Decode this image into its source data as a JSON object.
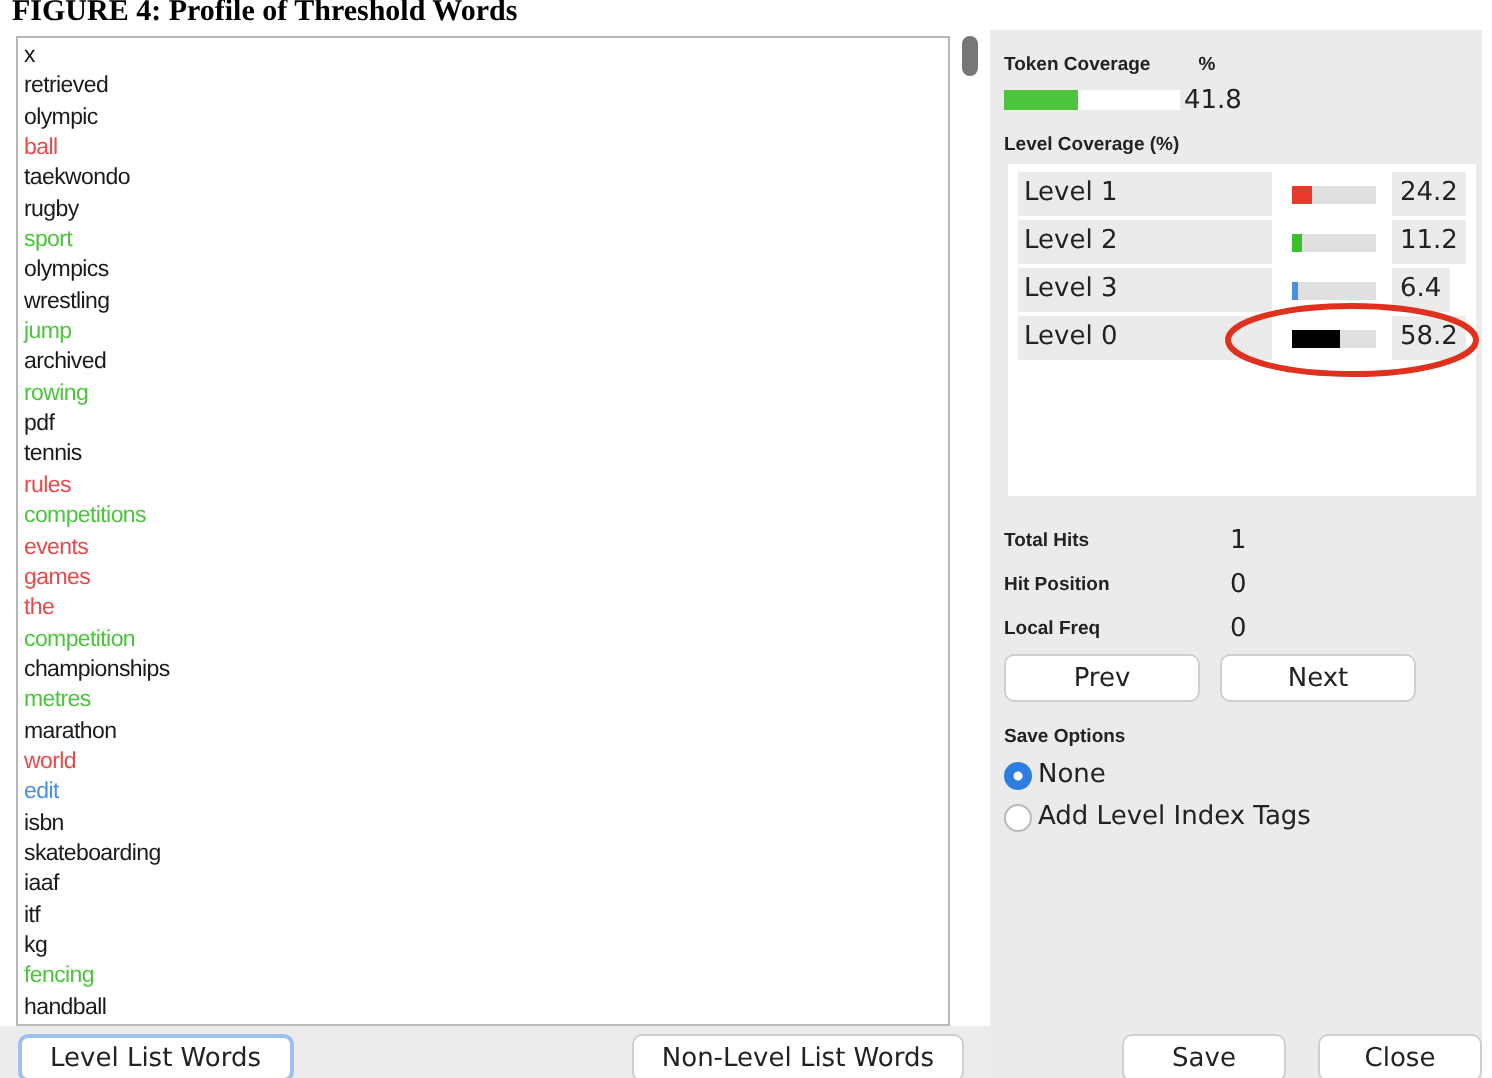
{
  "caption": "FIGURE 4: Profile of Threshold Words",
  "words": [
    {
      "text": "x",
      "color": "#1a1a1a"
    },
    {
      "text": "retrieved",
      "color": "#1a1a1a"
    },
    {
      "text": "olympic",
      "color": "#1a1a1a"
    },
    {
      "text": "ball",
      "color": "#e84a4a"
    },
    {
      "text": "taekwondo",
      "color": "#1a1a1a"
    },
    {
      "text": "rugby",
      "color": "#1a1a1a"
    },
    {
      "text": "sport",
      "color": "#4cc43c"
    },
    {
      "text": "olympics",
      "color": "#1a1a1a"
    },
    {
      "text": "wrestling",
      "color": "#1a1a1a"
    },
    {
      "text": "jump",
      "color": "#4cc43c"
    },
    {
      "text": "archived",
      "color": "#1a1a1a"
    },
    {
      "text": "rowing",
      "color": "#4cc43c"
    },
    {
      "text": "pdf",
      "color": "#1a1a1a"
    },
    {
      "text": "tennis",
      "color": "#1a1a1a"
    },
    {
      "text": "rules",
      "color": "#e84a4a"
    },
    {
      "text": "competitions",
      "color": "#4cc43c"
    },
    {
      "text": "events",
      "color": "#e84a4a"
    },
    {
      "text": "games",
      "color": "#e84a4a"
    },
    {
      "text": "the",
      "color": "#e84a4a"
    },
    {
      "text": "competition",
      "color": "#4cc43c"
    },
    {
      "text": "championships",
      "color": "#1a1a1a"
    },
    {
      "text": "metres",
      "color": "#4cc43c"
    },
    {
      "text": "marathon",
      "color": "#1a1a1a"
    },
    {
      "text": "world",
      "color": "#e84a4a"
    },
    {
      "text": "edit",
      "color": "#4a8fe2"
    },
    {
      "text": "isbn",
      "color": "#1a1a1a"
    },
    {
      "text": "skateboarding",
      "color": "#1a1a1a"
    },
    {
      "text": "iaaf",
      "color": "#1a1a1a"
    },
    {
      "text": "itf",
      "color": "#1a1a1a"
    },
    {
      "text": "kg",
      "color": "#1a1a1a"
    },
    {
      "text": "fencing",
      "color": "#4cc43c"
    },
    {
      "text": "handball",
      "color": "#1a1a1a"
    }
  ],
  "list_buttons": [
    {
      "label": "Level List Words",
      "selected": true
    },
    {
      "label": "Non-Level List Words",
      "selected": false
    }
  ],
  "token_coverage": {
    "label": "Token Coverage",
    "unit": "%",
    "level": 0.418,
    "reading": "41.8"
  },
  "level_coverage": {
    "title": "Level Coverage (%)",
    "rows": [
      {
        "label": "Level 1",
        "color": "#e8392c",
        "level": 0.242,
        "reading": "24.2",
        "circled": false
      },
      {
        "label": "Level 2",
        "color": "#3cbf2c",
        "level": 0.112,
        "reading": "11.2",
        "circled": false
      },
      {
        "label": "Level 3",
        "color": "#4a8fe2",
        "level": 0.064,
        "reading": "6.4",
        "circled": false
      },
      {
        "label": "Level 0",
        "color": "#000000",
        "level": 0.582,
        "reading": "58.2",
        "circled": true
      }
    ]
  },
  "stats": [
    {
      "label": "Total Hits",
      "value": "1"
    },
    {
      "label": "Hit Position",
      "value": "0"
    },
    {
      "label": "Local Freq",
      "value": "0"
    }
  ],
  "nav_buttons": [
    "Prev",
    "Next"
  ],
  "save_options": {
    "title": "Save Options",
    "options": [
      {
        "label": "None",
        "selected": true
      },
      {
        "label": "Add Level Index Tags",
        "selected": false
      }
    ]
  },
  "footer_buttons": [
    "Save",
    "Close"
  ]
}
